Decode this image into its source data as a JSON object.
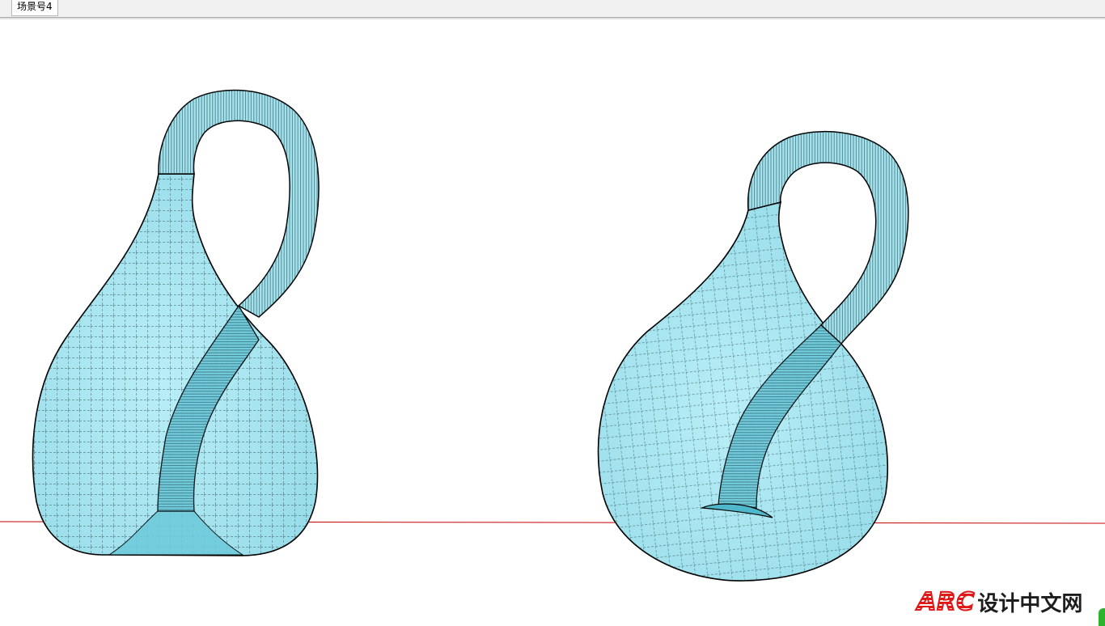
{
  "window": {
    "scene_tabs": [
      {
        "label": "场景号4",
        "active": true
      }
    ]
  },
  "viewport": {
    "models": [
      {
        "name": "klein-bottle-left",
        "icon": "klein-bottle",
        "color": "#aee8f2",
        "edge_color": "#000000"
      },
      {
        "name": "klein-bottle-right",
        "icon": "klein-bottle",
        "color": "#aee8f2",
        "edge_color": "#000000"
      }
    ],
    "axis_color": "#c40000"
  },
  "watermark": {
    "logo_text": "ARC",
    "site_text": "设计中文网",
    "logo_color": "#e01818"
  }
}
